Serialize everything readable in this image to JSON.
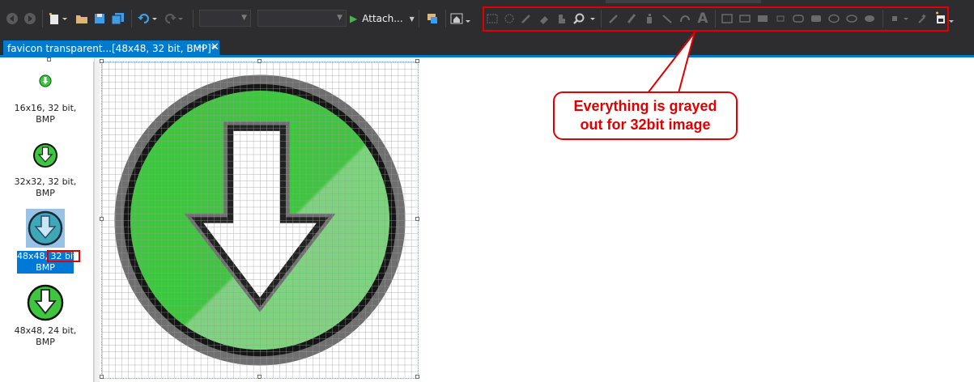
{
  "toolbar": {
    "attach_label": "Attach...",
    "attach_dropdown_icon": "chevron-down-icon",
    "icons": [
      "back-icon",
      "forward-icon",
      "new-item-icon",
      "open-folder-icon",
      "save-icon",
      "save-all-icon",
      "undo-icon",
      "redo-icon",
      "play-icon",
      "find-in-files-icon",
      "home-icon",
      "rect-select-icon",
      "lasso-select-icon",
      "color-picker-icon",
      "eraser-icon",
      "fill-icon",
      "zoom-icon",
      "pencil-icon",
      "brush-icon",
      "airbrush-icon",
      "line-icon",
      "curve-icon",
      "text-icon",
      "rectangle-outline-icon",
      "rectangle-filled-icon",
      "rounded-rect-icon",
      "ellipse-icon",
      "color-swatch-icon",
      "magic-wand-icon",
      "new-image-type-icon"
    ],
    "text_tool_glyph": "A"
  },
  "document_tab": {
    "title": "favicon transparent...[48x48, 32 bit, BMP]*",
    "pin_glyph": "⊣",
    "close_glyph": "✕"
  },
  "image_types": [
    {
      "label_line1": "16x16, 32 bit,",
      "label_line2": "BMP",
      "selected": false
    },
    {
      "label_line1": "32x32, 32 bit,",
      "label_line2": "BMP",
      "selected": false
    },
    {
      "label_prefix": "48x48,",
      "label_highlight": " 32 bit,",
      "label_line2": "BMP",
      "selected": true
    },
    {
      "label_line1": "48x48, 24 bit,",
      "label_line2": "BMP",
      "selected": false
    }
  ],
  "callout": {
    "line1": "Everything is grayed",
    "line2": "out for 32bit image"
  },
  "colors": {
    "vs_dark": "#2d2d30",
    "accent_blue": "#007acc",
    "annotation_red": "#e00000",
    "icon_green": "#3ec63e",
    "icon_light_green": "#7ed47e"
  }
}
